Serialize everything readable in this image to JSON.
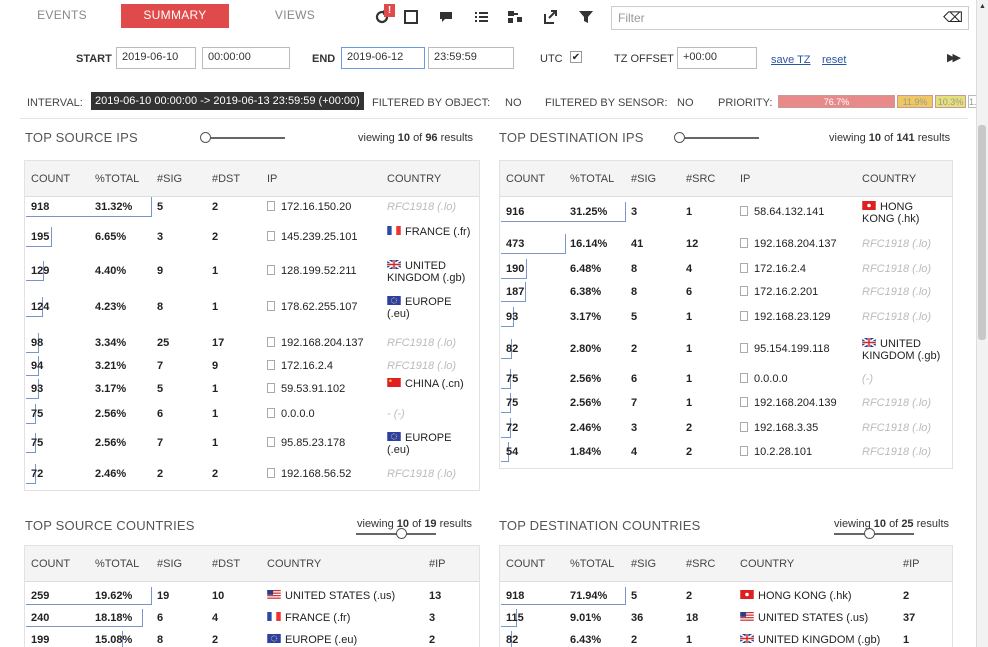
{
  "tabs": [
    "EVENTS",
    "SUMMARY",
    "VIEWS"
  ],
  "icons": [
    "refresh-icon",
    "square-icon",
    "comment-icon",
    "list-icon",
    "sitemap-icon",
    "export-icon",
    "filter-icon"
  ],
  "alert_badge": "!",
  "filter": {
    "placeholder": "Filter",
    "clear": "⌫"
  },
  "time": {
    "start_label": "START",
    "start_date": "2019-06-10",
    "start_time": "00:00:00",
    "end_label": "END",
    "end_date": "2019-06-12",
    "end_time": "23:59:59",
    "utc_label": "UTC",
    "utc_check": "✔",
    "tz_label": "TZ OFFSET",
    "tz_value": "+00:00",
    "save_tz": "save TZ",
    "reset": "reset",
    "play": "▶▶"
  },
  "info": {
    "interval_label": "INTERVAL:",
    "interval": "2019-06-10 00:00:00 -> 2019-06-13 23:59:59 (+00:00)",
    "fobj_label": "FILTERED BY OBJECT:",
    "fobj": "NO",
    "fsens_label": "FILTERED BY SENSOR:",
    "fsens": "NO",
    "prio_label": "PRIORITY:",
    "prio": [
      {
        "label": "76.7%",
        "value": 76.7,
        "color": "#e88a8a"
      },
      {
        "label": "11.9%",
        "value": 11.9,
        "color": "#f0c860"
      },
      {
        "label": "10.3%",
        "value": 10.3,
        "color": "#e6e07a"
      },
      {
        "label": "1.2%",
        "value": 1.2,
        "color": "#ffffff"
      }
    ]
  },
  "src_ips": {
    "title": "TOP SOURCE IPS",
    "viewing": "viewing",
    "shown": "10",
    "of": "of",
    "total": "96",
    "results": "results",
    "cols": [
      "COUNT",
      "%TOTAL",
      "#SIG",
      "#DST",
      "IP",
      "COUNTRY"
    ],
    "rows": [
      {
        "count": "918",
        "pct": "31.32%",
        "sig": "5",
        "dst": "2",
        "ip": "172.16.150.20",
        "country": "RFC1918 (.lo)",
        "flag": "",
        "gray": true,
        "frac": 1.0
      },
      {
        "count": "195",
        "pct": "6.65%",
        "sig": "3",
        "dst": "2",
        "ip": "145.239.25.101",
        "country": "FRANCE (.fr)",
        "flag": "fr",
        "gray": false,
        "frac": 0.21
      },
      {
        "count": "129",
        "pct": "4.40%",
        "sig": "9",
        "dst": "1",
        "ip": "128.199.52.211",
        "country": "UNITED KINGDOM (.gb)",
        "flag": "gb",
        "gray": false,
        "frac": 0.14
      },
      {
        "count": "124",
        "pct": "4.23%",
        "sig": "8",
        "dst": "1",
        "ip": "178.62.255.107",
        "country": "EUROPE (.eu)",
        "flag": "eu",
        "gray": false,
        "frac": 0.135
      },
      {
        "count": "98",
        "pct": "3.34%",
        "sig": "25",
        "dst": "17",
        "ip": "192.168.204.137",
        "country": "RFC1918 (.lo)",
        "flag": "",
        "gray": true,
        "frac": 0.107
      },
      {
        "count": "94",
        "pct": "3.21%",
        "sig": "7",
        "dst": "9",
        "ip": "172.16.2.4",
        "country": "RFC1918 (.lo)",
        "flag": "",
        "gray": true,
        "frac": 0.102
      },
      {
        "count": "93",
        "pct": "3.17%",
        "sig": "5",
        "dst": "1",
        "ip": "59.53.91.102",
        "country": "CHINA (.cn)",
        "flag": "cn",
        "gray": false,
        "frac": 0.101
      },
      {
        "count": "75",
        "pct": "2.56%",
        "sig": "6",
        "dst": "1",
        "ip": "0.0.0.0",
        "country": "- (-)",
        "flag": "",
        "gray": true,
        "frac": 0.082
      },
      {
        "count": "75",
        "pct": "2.56%",
        "sig": "7",
        "dst": "1",
        "ip": "95.85.23.178",
        "country": "EUROPE (.eu)",
        "flag": "eu",
        "gray": false,
        "frac": 0.082
      },
      {
        "count": "72",
        "pct": "2.46%",
        "sig": "2",
        "dst": "2",
        "ip": "192.168.56.52",
        "country": "RFC1918 (.lo)",
        "flag": "",
        "gray": true,
        "frac": 0.078
      }
    ]
  },
  "dst_ips": {
    "title": "TOP DESTINATION IPS",
    "viewing": "viewing",
    "shown": "10",
    "of": "of",
    "total": "141",
    "results": "results",
    "cols": [
      "COUNT",
      "%TOTAL",
      "#SIG",
      "#SRC",
      "IP",
      "COUNTRY"
    ],
    "rows": [
      {
        "count": "916",
        "pct": "31.25%",
        "sig": "3",
        "dst": "1",
        "ip": "58.64.132.141",
        "country": "HONG KONG (.hk)",
        "flag": "hk",
        "gray": false,
        "frac": 1.0
      },
      {
        "count": "473",
        "pct": "16.14%",
        "sig": "41",
        "dst": "12",
        "ip": "192.168.204.137",
        "country": "RFC1918 (.lo)",
        "flag": "",
        "gray": true,
        "frac": 0.52
      },
      {
        "count": "190",
        "pct": "6.48%",
        "sig": "8",
        "dst": "4",
        "ip": "172.16.2.4",
        "country": "RFC1918 (.lo)",
        "flag": "",
        "gray": true,
        "frac": 0.21
      },
      {
        "count": "187",
        "pct": "6.38%",
        "sig": "8",
        "dst": "6",
        "ip": "172.16.2.201",
        "country": "RFC1918 (.lo)",
        "flag": "",
        "gray": true,
        "frac": 0.2
      },
      {
        "count": "93",
        "pct": "3.17%",
        "sig": "5",
        "dst": "1",
        "ip": "192.168.23.129",
        "country": "RFC1918 (.lo)",
        "flag": "",
        "gray": true,
        "frac": 0.1
      },
      {
        "count": "82",
        "pct": "2.80%",
        "sig": "2",
        "dst": "1",
        "ip": "95.154.199.118",
        "country": "UNITED KINGDOM (.gb)",
        "flag": "gb",
        "gray": false,
        "frac": 0.09
      },
      {
        "count": "75",
        "pct": "2.56%",
        "sig": "6",
        "dst": "1",
        "ip": "0.0.0.0",
        "country": "(-)",
        "flag": "",
        "gray": true,
        "frac": 0.082
      },
      {
        "count": "75",
        "pct": "2.56%",
        "sig": "7",
        "dst": "1",
        "ip": "192.168.204.139",
        "country": "RFC1918 (.lo)",
        "flag": "",
        "gray": true,
        "frac": 0.082
      },
      {
        "count": "72",
        "pct": "2.46%",
        "sig": "3",
        "dst": "2",
        "ip": "192.168.3.35",
        "country": "RFC1918 (.lo)",
        "flag": "",
        "gray": true,
        "frac": 0.079
      },
      {
        "count": "54",
        "pct": "1.84%",
        "sig": "4",
        "dst": "2",
        "ip": "10.2.28.101",
        "country": "RFC1918 (.lo)",
        "flag": "",
        "gray": true,
        "frac": 0.059
      }
    ]
  },
  "src_countries": {
    "title": "TOP SOURCE COUNTRIES",
    "viewing": "viewing",
    "shown": "10",
    "of": "of",
    "total": "19",
    "results": "results",
    "cols": [
      "COUNT",
      "%TOTAL",
      "#SIG",
      "#DST",
      "COUNTRY",
      "#IP"
    ],
    "rows": [
      {
        "count": "259",
        "pct": "19.62%",
        "sig": "19",
        "dst": "10",
        "country": "UNITED STATES (.us)",
        "flag": "us",
        "ipc": "13",
        "frac": 1.0
      },
      {
        "count": "240",
        "pct": "18.18%",
        "sig": "6",
        "dst": "4",
        "country": "FRANCE (.fr)",
        "flag": "fr",
        "ipc": "3",
        "frac": 0.93
      },
      {
        "count": "199",
        "pct": "15.08%",
        "sig": "8",
        "dst": "2",
        "country": "EUROPE (.eu)",
        "flag": "eu",
        "ipc": "2",
        "frac": 0.77
      }
    ]
  },
  "dst_countries": {
    "title": "TOP DESTINATION COUNTRIES",
    "viewing": "viewing",
    "shown": "10",
    "of": "of",
    "total": "25",
    "results": "results",
    "cols": [
      "COUNT",
      "%TOTAL",
      "#SIG",
      "#SRC",
      "COUNTRY",
      "#IP"
    ],
    "rows": [
      {
        "count": "918",
        "pct": "71.94%",
        "sig": "5",
        "dst": "2",
        "country": "HONG KONG (.hk)",
        "flag": "hk",
        "ipc": "2",
        "frac": 1.0
      },
      {
        "count": "115",
        "pct": "9.01%",
        "sig": "36",
        "dst": "18",
        "country": "UNITED STATES (.us)",
        "flag": "us",
        "ipc": "37",
        "frac": 0.13
      },
      {
        "count": "82",
        "pct": "6.43%",
        "sig": "2",
        "dst": "1",
        "country": "UNITED KINGDOM (.gb)",
        "flag": "gb",
        "ipc": "1",
        "frac": 0.09
      }
    ]
  }
}
